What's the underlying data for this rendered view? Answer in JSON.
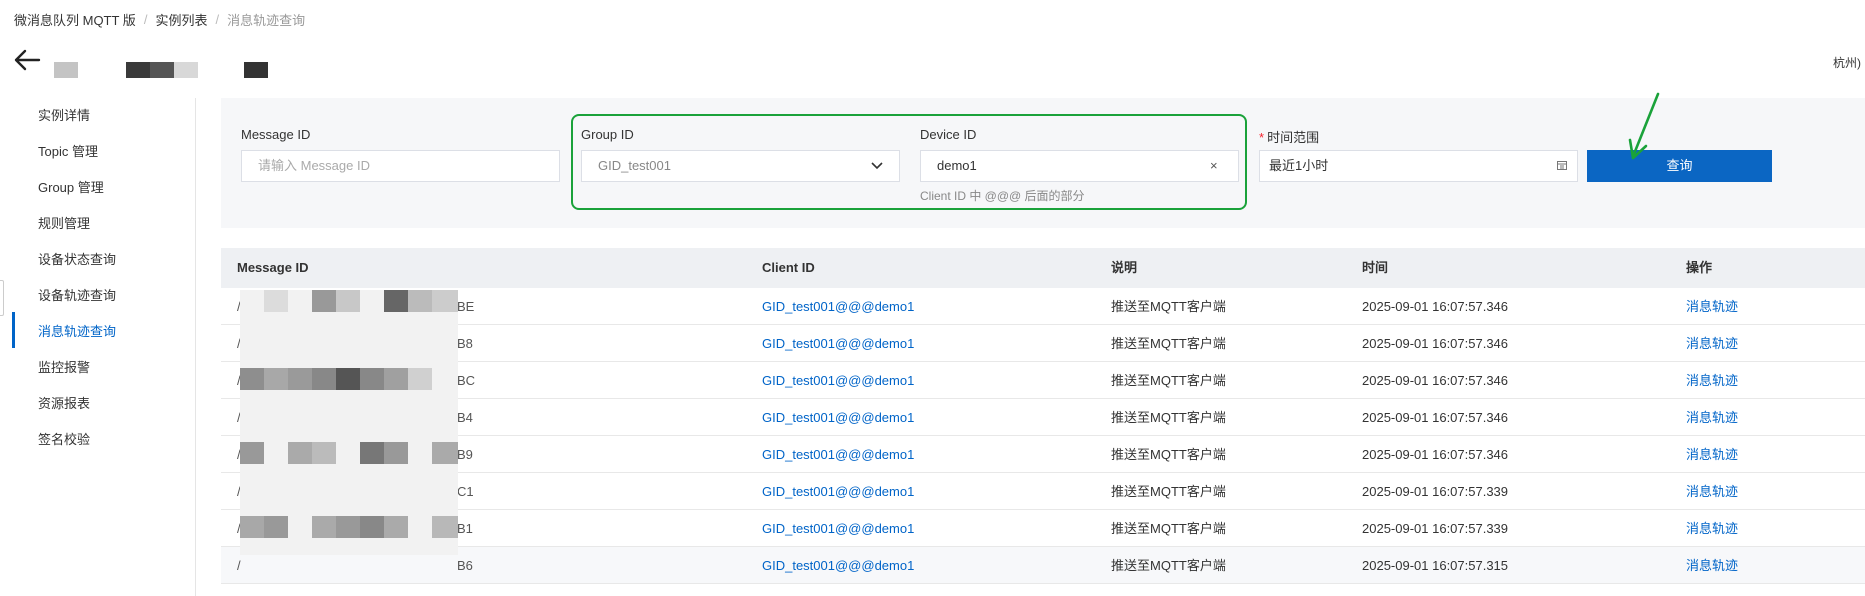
{
  "breadcrumb": {
    "item1": "微消息队列 MQTT 版",
    "item2": "实例列表",
    "current": "消息轨迹查询",
    "sep": "/"
  },
  "header": {
    "region_suffix": "杭州)"
  },
  "sidebar": {
    "items": [
      {
        "label": "实例详情"
      },
      {
        "label": "Topic 管理"
      },
      {
        "label": "Group 管理"
      },
      {
        "label": "规则管理"
      },
      {
        "label": "设备状态查询"
      },
      {
        "label": "设备轨迹查询"
      },
      {
        "label": "消息轨迹查询",
        "active": true
      },
      {
        "label": "监控报警"
      },
      {
        "label": "资源报表"
      },
      {
        "label": "签名校验"
      }
    ]
  },
  "filter": {
    "message_id_label": "Message ID",
    "message_id_placeholder": "请输入 Message ID",
    "group_id_label": "Group ID",
    "group_id_value": "GID_test001",
    "device_id_label": "Device ID",
    "device_id_value": "demo1",
    "device_id_hint": "Client ID 中 @@@ 后面的部分",
    "time_label": "时间范围",
    "time_required_mark": "*",
    "time_value": "最近1小时",
    "query_button": "查询",
    "clear_icon": "×"
  },
  "table": {
    "headers": {
      "message_id": "Message ID",
      "client_id": "Client ID",
      "desc": "说明",
      "time": "时间",
      "action": "操作"
    },
    "rows": [
      {
        "msg_prefix": "/",
        "msg_suffix": "BE",
        "client_id": "GID_test001@@@demo1",
        "desc": "推送至MQTT客户端",
        "time": "2025-09-01 16:07:57.346",
        "action": "消息轨迹"
      },
      {
        "msg_prefix": "/",
        "msg_suffix": "B8",
        "client_id": "GID_test001@@@demo1",
        "desc": "推送至MQTT客户端",
        "time": "2025-09-01 16:07:57.346",
        "action": "消息轨迹"
      },
      {
        "msg_prefix": "/",
        "msg_suffix": "BC",
        "client_id": "GID_test001@@@demo1",
        "desc": "推送至MQTT客户端",
        "time": "2025-09-01 16:07:57.346",
        "action": "消息轨迹"
      },
      {
        "msg_prefix": "/",
        "msg_suffix": "B4",
        "client_id": "GID_test001@@@demo1",
        "desc": "推送至MQTT客户端",
        "time": "2025-09-01 16:07:57.346",
        "action": "消息轨迹"
      },
      {
        "msg_prefix": "/",
        "msg_suffix": "B9",
        "client_id": "GID_test001@@@demo1",
        "desc": "推送至MQTT客户端",
        "time": "2025-09-01 16:07:57.346",
        "action": "消息轨迹"
      },
      {
        "msg_prefix": "/",
        "msg_suffix": "C1",
        "client_id": "GID_test001@@@demo1",
        "desc": "推送至MQTT客户端",
        "time": "2025-09-01 16:07:57.339",
        "action": "消息轨迹"
      },
      {
        "msg_prefix": "/",
        "msg_suffix": "B1",
        "client_id": "GID_test001@@@demo1",
        "desc": "推送至MQTT客户端",
        "time": "2025-09-01 16:07:57.339",
        "action": "消息轨迹"
      },
      {
        "msg_prefix": "/",
        "msg_suffix": "B6",
        "client_id": "GID_test001@@@demo1",
        "desc": "推送至MQTT客户端",
        "time": "2025-09-01 16:07:57.315",
        "action": "消息轨迹"
      }
    ]
  },
  "colors": {
    "primary": "#0b66c3",
    "link": "#0064c8",
    "highlight_box": "#1aa23a"
  },
  "icons": {
    "back": "arrow-left-icon",
    "dropdown": "chevron-down-icon",
    "clear": "close-icon",
    "calendar": "calendar-icon"
  }
}
